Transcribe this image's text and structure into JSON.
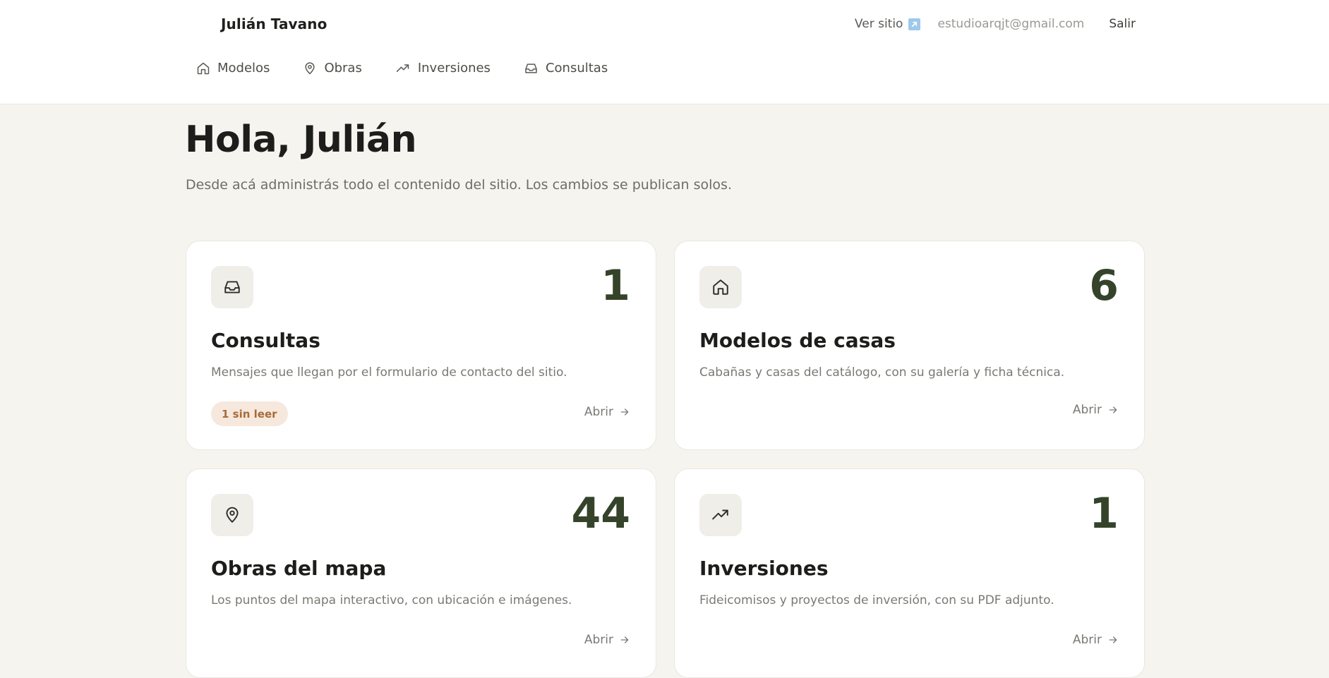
{
  "header": {
    "brand": "Julián Tavano",
    "view_site_label": "Ver sitio",
    "user_email": "estudioarqjt@gmail.com",
    "logout_label": "Salir"
  },
  "nav": {
    "items": [
      {
        "label": "Modelos",
        "icon": "home-icon"
      },
      {
        "label": "Obras",
        "icon": "map-pin-icon"
      },
      {
        "label": "Inversiones",
        "icon": "trending-up-icon"
      },
      {
        "label": "Consultas",
        "icon": "inbox-icon"
      }
    ]
  },
  "main": {
    "title": "Hola, Julián",
    "subtitle": "Desde acá administrás todo el contenido del sitio. Los cambios se publican solos."
  },
  "cards": [
    {
      "icon": "inbox-icon",
      "count": "1",
      "title": "Consultas",
      "description": "Mensajes que llegan por el formulario de contacto del sitio.",
      "badge": "1 sin leer",
      "open_label": "Abrir"
    },
    {
      "icon": "home-icon",
      "count": "6",
      "title": "Modelos de casas",
      "description": "Cabañas y casas del catálogo, con su galería y ficha técnica.",
      "open_label": "Abrir"
    },
    {
      "icon": "map-pin-icon",
      "count": "44",
      "title": "Obras del mapa",
      "description": "Los puntos del mapa interactivo, con ubicación e imágenes.",
      "open_label": "Abrir"
    },
    {
      "icon": "trending-up-icon",
      "count": "1",
      "title": "Inversiones",
      "description": "Fideicomisos y proyectos de inversión, con su PDF adjunto.",
      "open_label": "Abrir"
    }
  ],
  "colors": {
    "background": "#f5f4ef",
    "accent_count": "#35432a",
    "badge_bg": "#f6e8dc",
    "badge_text": "#a86b3b",
    "external_link_icon": "#9ec9ea"
  }
}
